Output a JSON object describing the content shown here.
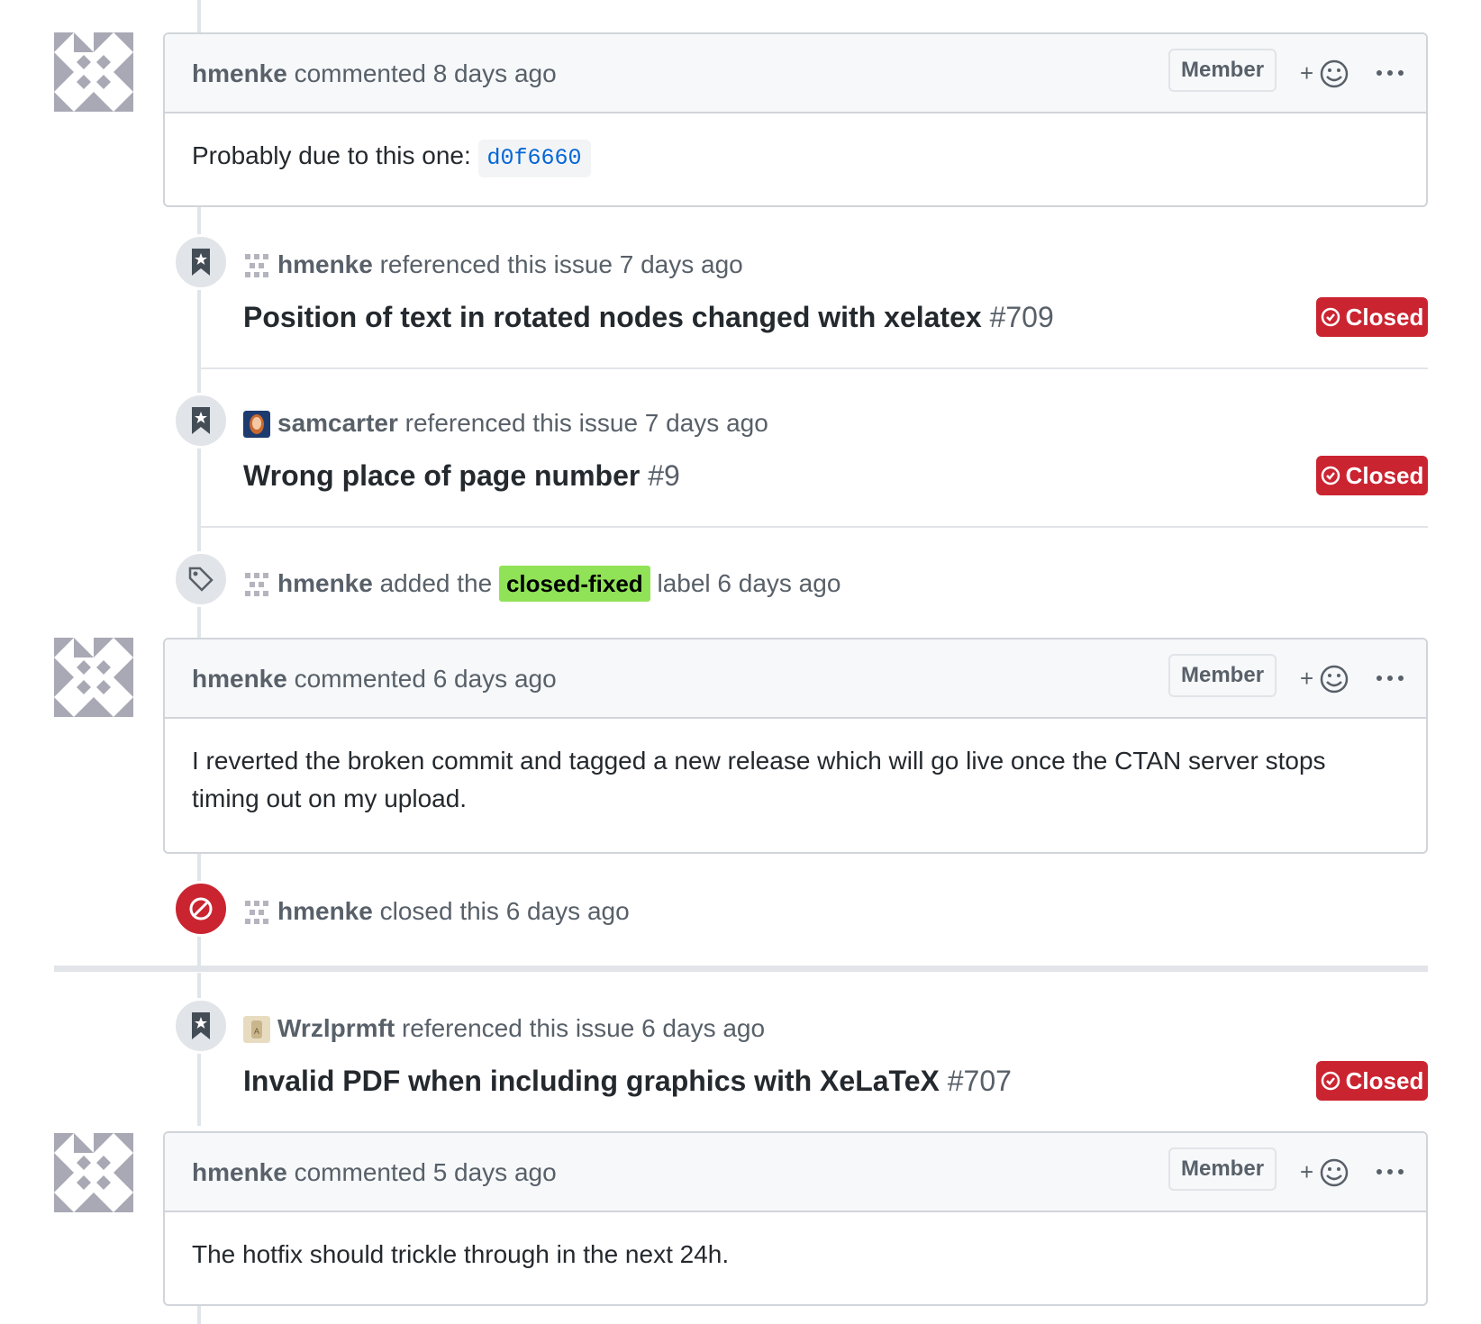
{
  "comments": [
    {
      "author": "hmenke",
      "action": "commented",
      "time": "8 days ago",
      "role": "Member",
      "body_prefix": "Probably due to this one:",
      "commit": "d0f6660"
    },
    {
      "author": "hmenke",
      "action": "commented",
      "time": "6 days ago",
      "role": "Member",
      "body": "I reverted the broken commit and tagged a new release which will go live once the CTAN server stops timing out on my upload."
    },
    {
      "author": "hmenke",
      "action": "commented",
      "time": "5 days ago",
      "role": "Member",
      "body": "The hotfix should trickle through in the next 24h."
    }
  ],
  "references": [
    {
      "author": "hmenke",
      "action": "referenced this issue",
      "time": "7 days ago",
      "title": "Position of text in rotated nodes changed with xelatex",
      "number": "#709",
      "state": "Closed"
    },
    {
      "author": "samcarter",
      "action": "referenced this issue",
      "time": "7 days ago",
      "title": "Wrong place of page number",
      "number": "#9",
      "state": "Closed"
    },
    {
      "author": "Wrzlprmft",
      "action": "referenced this issue",
      "time": "6 days ago",
      "title": "Invalid PDF when including graphics with XeLaTeX",
      "number": "#707",
      "state": "Closed"
    }
  ],
  "label_event": {
    "author": "hmenke",
    "pre": "added the",
    "label": "closed-fixed",
    "post": "label 6 days ago"
  },
  "close_event": {
    "author": "hmenke",
    "action": "closed this",
    "time": "6 days ago"
  },
  "colors": {
    "closed": "#cb2431",
    "label": "#90e357",
    "link": "#0366d6"
  },
  "icons": {
    "reference": "bookmark-icon",
    "label": "tag-icon",
    "closed": "circle-slash-icon",
    "reaction": "smiley-icon",
    "more": "kebab-icon"
  }
}
